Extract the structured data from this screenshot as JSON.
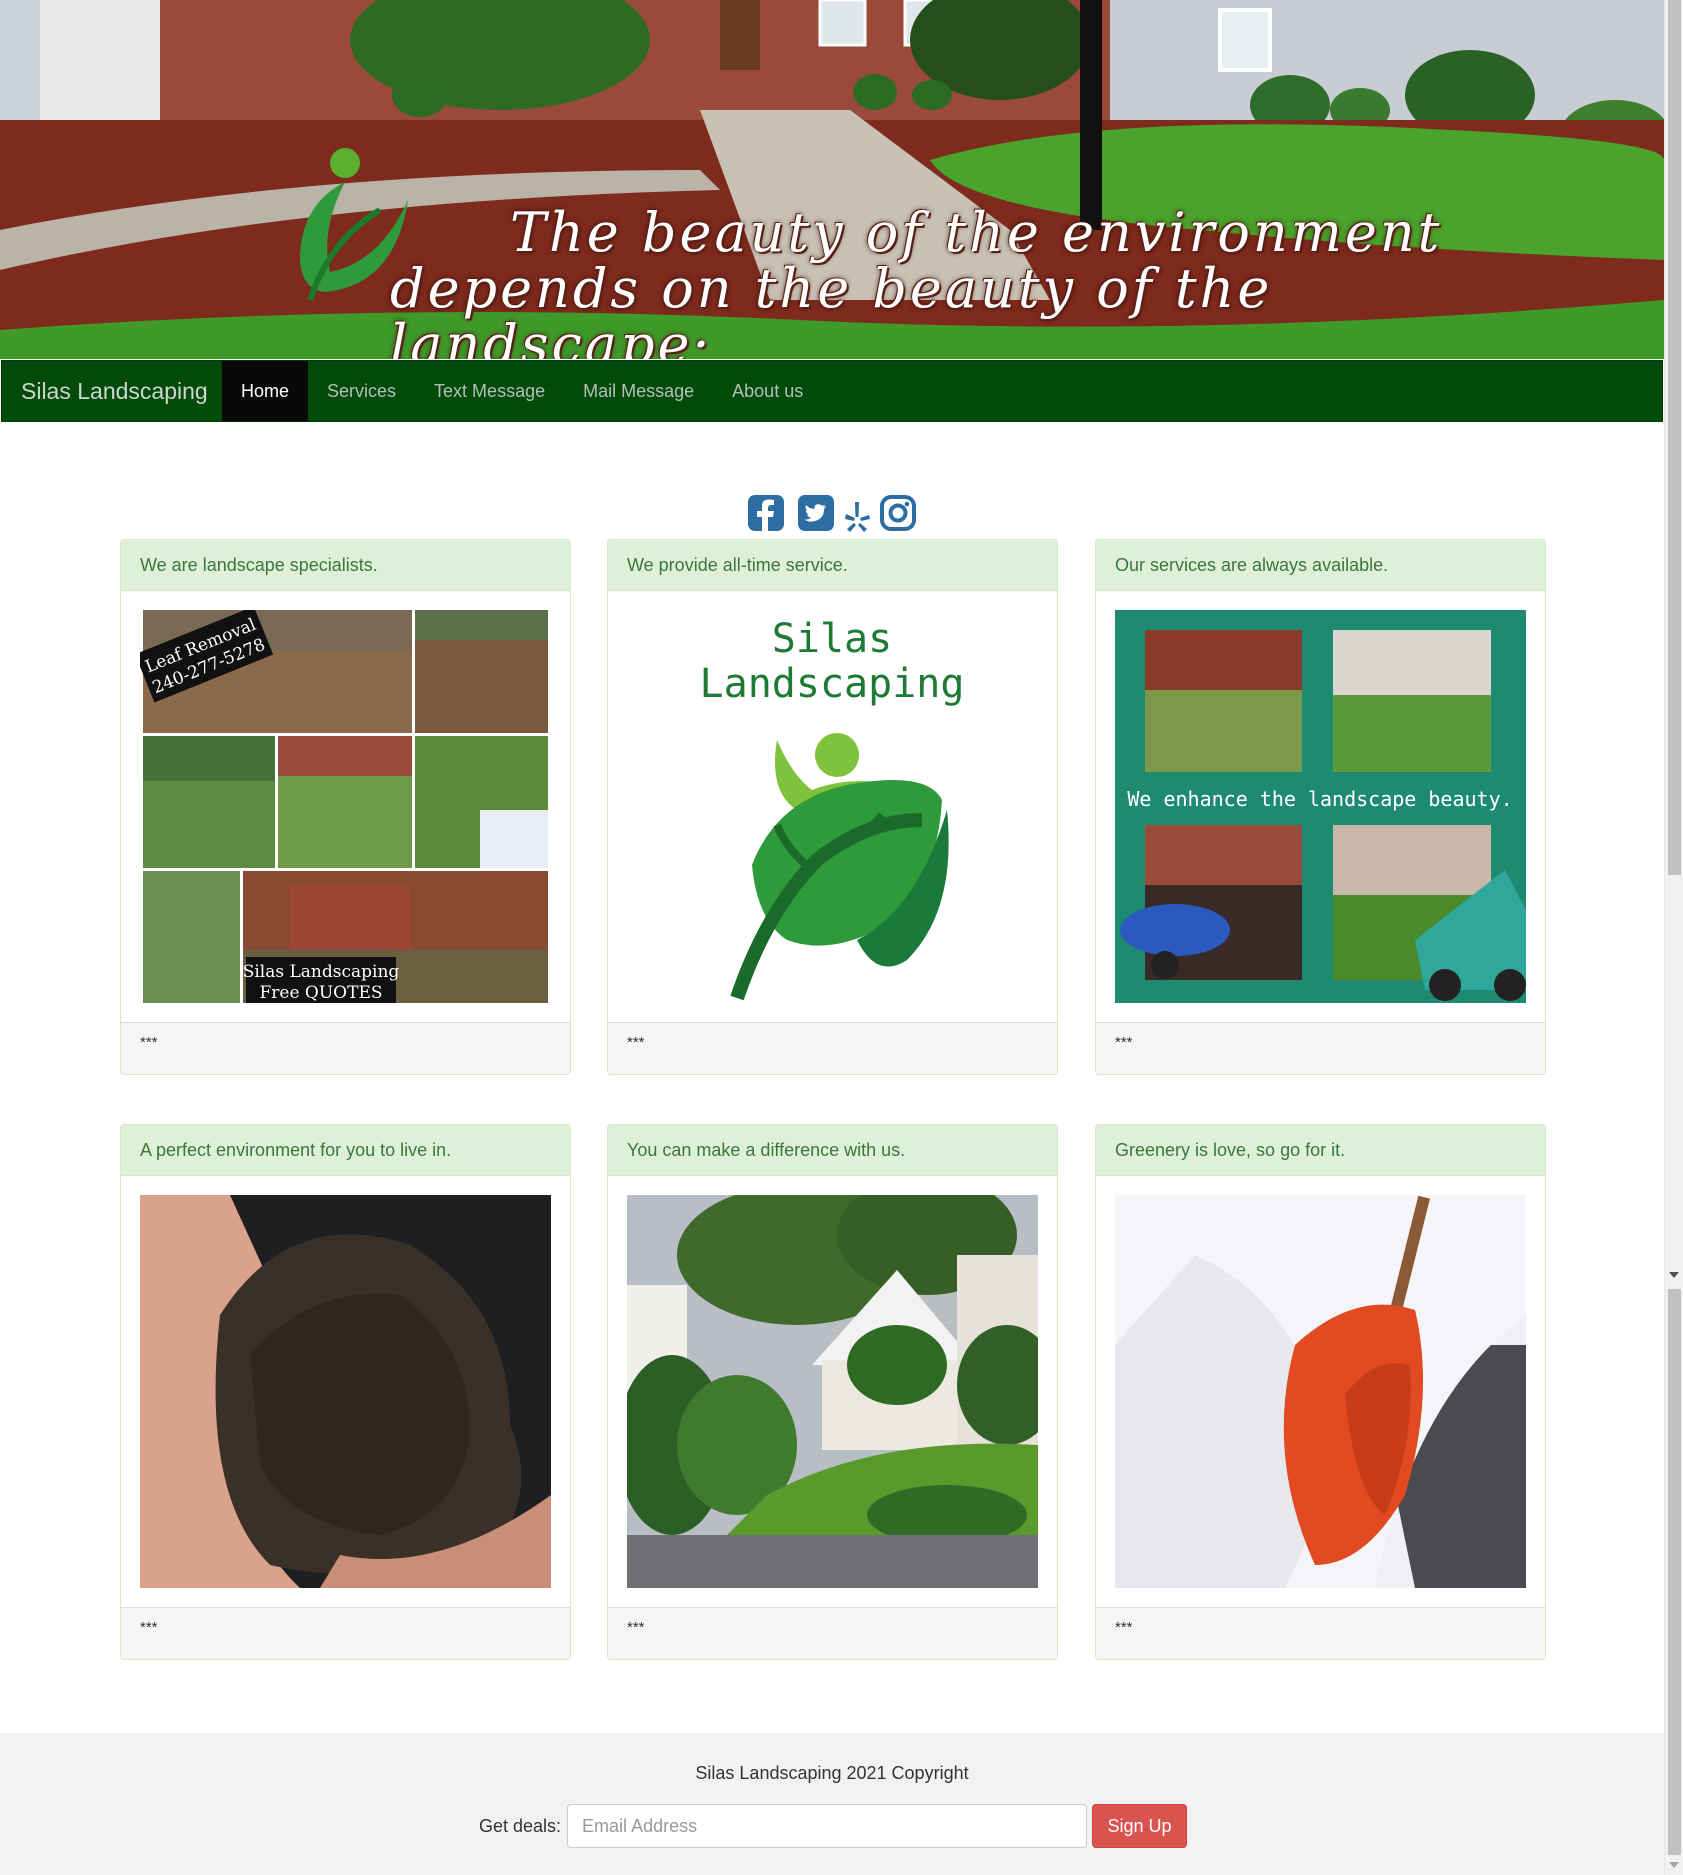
{
  "hero": {
    "tagline_line1": "The beauty of the environment",
    "tagline_line2": "depends on the beauty of the landscape·"
  },
  "navbar": {
    "brand": "Silas Landscaping",
    "items": [
      {
        "label": "Home",
        "active": true
      },
      {
        "label": "Services",
        "active": false
      },
      {
        "label": "Text Message",
        "active": false
      },
      {
        "label": "Mail Message",
        "active": false
      },
      {
        "label": "About us",
        "active": false
      }
    ]
  },
  "social": {
    "icons": [
      "facebook-icon",
      "twitter-icon",
      "yelp-icon",
      "instagram-icon"
    ],
    "color": "#2e6da4"
  },
  "panels": [
    {
      "heading": "We are landscape specialists.",
      "image": "leaf-removal-collage",
      "image_text_1": "Leaf Removal",
      "image_text_2": "240-277-5278",
      "image_text_3": "Silas Landscaping",
      "image_text_4": "Free QUOTES",
      "footer": "***"
    },
    {
      "heading": "We provide all-time service.",
      "image": "silas-landscaping-logo",
      "image_text_1": "Silas",
      "image_text_2": "Landscaping",
      "footer": "***"
    },
    {
      "heading": "Our services are always available.",
      "image": "landscape-collage",
      "image_text_1": "We enhance the landscape beauty.",
      "footer": "***"
    },
    {
      "heading": "A perfect environment for you to live in.",
      "image": "soil-in-hand",
      "footer": "***"
    },
    {
      "heading": "You can make a difference with us.",
      "image": "house-lawn",
      "footer": "***"
    },
    {
      "heading": "Greenery is love, so go for it.",
      "image": "snow-shovel",
      "footer": "***"
    }
  ],
  "footer": {
    "copyright": "Silas Landscaping 2021 Copyright",
    "deals_label": "Get deals:",
    "email_placeholder": "Email Address",
    "signup_label": "Sign Up"
  },
  "colors": {
    "navbar_bg": "#004a0a",
    "panel_heading_bg": "#dff0d8",
    "panel_heading_text": "#3c763d",
    "signup_bg": "#d9534f"
  }
}
